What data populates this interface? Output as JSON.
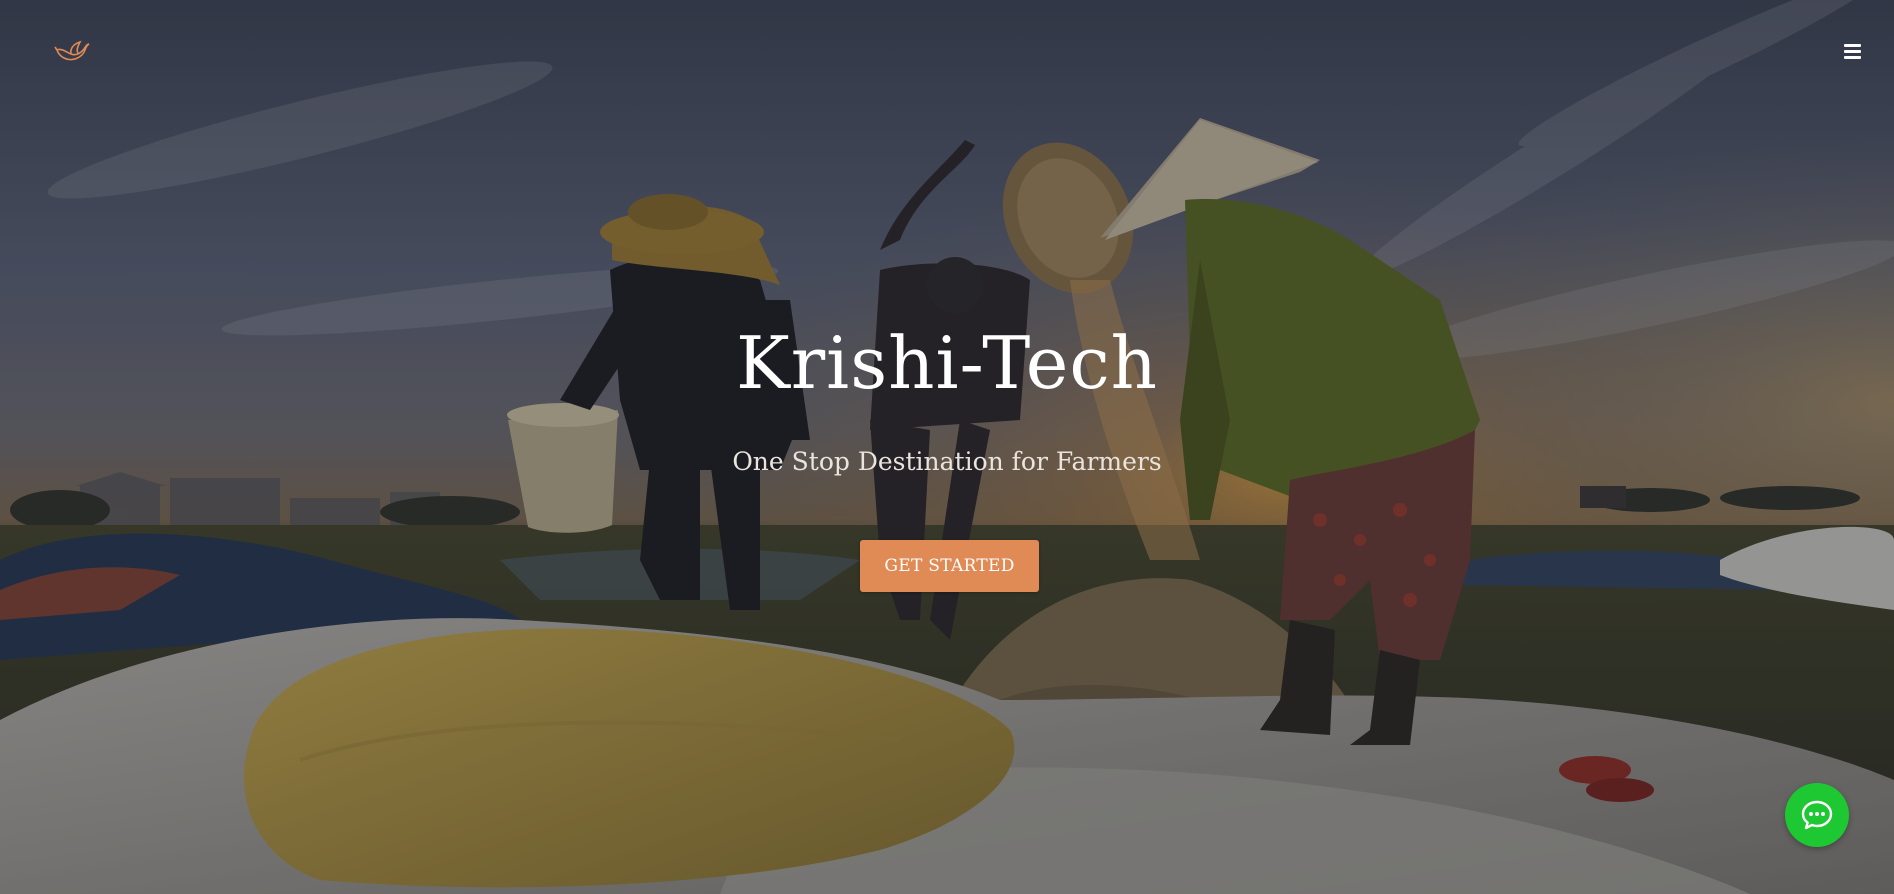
{
  "hero": {
    "title": "Krishi-Tech",
    "subtitle": "One Stop Destination for Farmers",
    "cta_label": "GET STARTED"
  },
  "header": {
    "logo_icon": "bird-icon",
    "menu_icon": "hamburger-menu-icon"
  },
  "chat": {
    "icon": "chat-bubble-icon"
  },
  "colors": {
    "accent": "#e08a55",
    "chat": "#1ec832",
    "text": "#ffffff"
  }
}
